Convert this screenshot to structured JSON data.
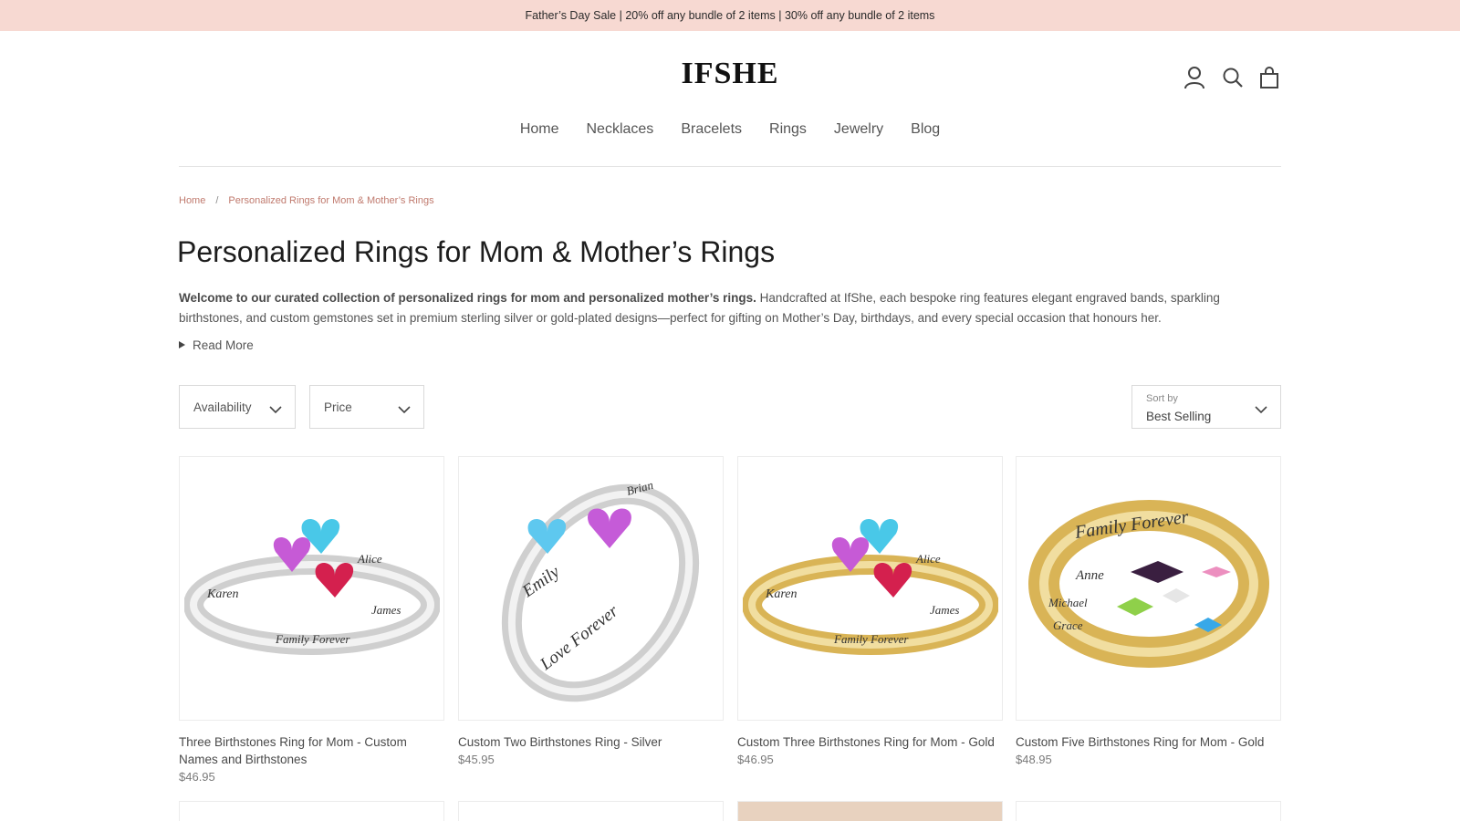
{
  "announcement": {
    "text": "Father’s Day Sale | 20% off any bundle of 2 items | 30% off any bundle of 2 items"
  },
  "header": {
    "logo": "IFSHE",
    "icons": [
      "account-icon",
      "search-icon",
      "cart-icon"
    ]
  },
  "nav": {
    "items": [
      "Home",
      "Necklaces",
      "Bracelets",
      "Rings",
      "Jewelry",
      "Blog"
    ]
  },
  "breadcrumb": {
    "home": "Home",
    "separator": "/",
    "current": "Personalized Rings for Mom & Mother’s Rings"
  },
  "page": {
    "title": "Personalized Rings for Mom & Mother’s Rings",
    "intro_bold": "Welcome to our curated collection of personalized rings for mom and personalized mother’s rings.",
    "intro_rest": " Handcrafted at IfShe, each bespoke ring features elegant engraved bands, sparkling birthstones, and custom gemstones set in premium sterling silver or gold-plated designs—perfect for gifting on Mother’s Day, birthdays, and every special occasion that honours her.",
    "read_more": "Read More"
  },
  "filters": {
    "availability": "Availability",
    "price": "Price",
    "sort_label": "Sort by",
    "sort_value": "Best Selling"
  },
  "products": [
    {
      "name": "Three Birthstones Ring for Mom - Custom Names and Birthstones",
      "price": "$46.95",
      "engraving": [
        "Karen",
        "Alice",
        "James",
        "Family Forever"
      ]
    },
    {
      "name": "Custom Two Birthstones Ring - Silver",
      "price": "$45.95",
      "engraving": [
        "Emily",
        "Brian",
        "Love Forever"
      ]
    },
    {
      "name": "Custom Three Birthstones Ring for Mom - Gold",
      "price": "$46.95",
      "engraving": [
        "Karen",
        "Alice",
        "James",
        "Family Forever"
      ]
    },
    {
      "name": "Custom Five Birthstones Ring for Mom - Gold",
      "price": "$48.95",
      "engraving": [
        "Family Forever",
        "Anne",
        "Michael",
        "Grace"
      ]
    }
  ],
  "colors": {
    "announcement_bg": "#f7d9d2",
    "breadcrumb": "#c07a6e",
    "silver": "#d8d8d8",
    "gold": "#d9b456"
  }
}
